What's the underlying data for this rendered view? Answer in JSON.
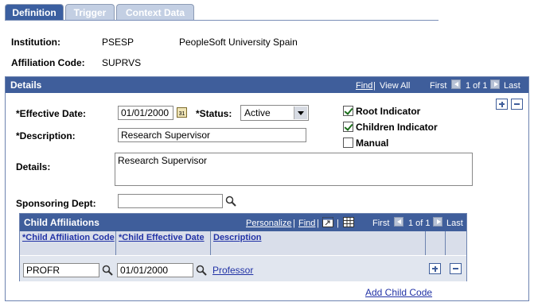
{
  "tabs": [
    {
      "label": "Definition",
      "active": true
    },
    {
      "label": "Trigger",
      "active": false
    },
    {
      "label": "Context Data",
      "active": false
    }
  ],
  "header": {
    "institution_label": "Institution:",
    "institution_code": "PSESP",
    "institution_name": "PeopleSoft University Spain",
    "affiliation_label": "Affiliation Code:",
    "affiliation_code": "SUPRVS"
  },
  "details": {
    "title": "Details",
    "nav": {
      "find": "Find",
      "view_all": "View All",
      "first": "First",
      "count": "1 of 1",
      "last": "Last"
    },
    "effective_date_label": "*Effective Date:",
    "effective_date_value": "01/01/2000",
    "calendar_text": "31",
    "status_label": "*Status:",
    "status_value": "Active",
    "description_label": "*Description:",
    "description_value": "Research Supervisor",
    "details_label": "Details:",
    "details_value": "Research Supervisor",
    "sponsoring_label": "Sponsoring Dept:",
    "sponsoring_value": "",
    "checkboxes": [
      {
        "label": "Root Indicator",
        "checked": true
      },
      {
        "label": "Children Indicator",
        "checked": true
      },
      {
        "label": "Manual",
        "checked": false
      }
    ]
  },
  "child_grid": {
    "title": "Child Affiliations",
    "nav": {
      "personalize": "Personalize",
      "find": "Find",
      "first": "First",
      "count": "1 of 1",
      "last": "Last"
    },
    "columns": [
      "*Child Affiliation Code",
      "*Child Effective Date",
      "Description"
    ],
    "rows": [
      {
        "code": "PROFR",
        "date": "01/01/2000",
        "description": "Professor"
      }
    ],
    "add_link": "Add Child Code"
  },
  "colors": {
    "header_blue": "#3f5e9b",
    "link_blue": "#2233a6",
    "grid_row": "#e1e6ef"
  }
}
